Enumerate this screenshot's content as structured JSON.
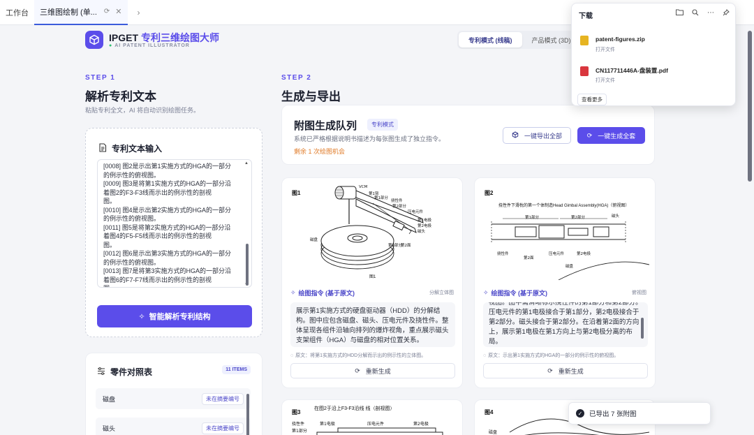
{
  "browser": {
    "tabs": [
      {
        "label": "工作台"
      },
      {
        "label": "三维图绘制 (单..."
      }
    ]
  },
  "header": {
    "brand_en": "IPGET",
    "brand_zh": "专利三维绘图大师",
    "subtitle": "AI PATENT ILLUSTRATOR",
    "modes": [
      "专利模式 (线稿)",
      "产品模式 (3D)"
    ],
    "active_mode": 0
  },
  "step1": {
    "label": "STEP 1",
    "title": "解析专利文本",
    "desc": "粘贴专利全文，AI 将自动识别绘图任务。",
    "input_title": "专利文本输入",
    "lines": [
      "[0008] 图2是示出第1实施方式的HGA的一部分",
      "的例示性的俯视图。",
      "[0009] 图3是将第1实施方式的HGA的一部分沿",
      "着图2的F3-F3线而示出的例示性的剖视",
      "图。",
      "[0010] 图4是示出第2实施方式的HGA的一部分",
      "的例示性的俯视图。",
      "[0011] 图5是将第2实施方式的HGA的一部分沿",
      "着图4的F5-F5线而示出的例示性的剖视",
      "图。",
      "[0012] 图6是示出第3实施方式的HGA的一部分",
      "的例示性的俯视图。",
      "[0013] 图7是将第3实施方式的HGA的一部分沿",
      "着图6的F7-F7线而示出的例示性的剖视",
      "图"
    ],
    "analyze_button": "智能解析专利结构"
  },
  "parts": {
    "title": "零件对照表",
    "count_badge": "11 ITEMS",
    "rows": [
      {
        "name": "磁盘",
        "tag": "未在摘要编号"
      },
      {
        "name": "磁头",
        "tag": "未在摘要编号"
      }
    ]
  },
  "step2": {
    "label": "STEP 2",
    "title": "生成与导出"
  },
  "queue": {
    "title": "附图生成队列",
    "badge": "专利模式",
    "desc": "系统已严格根据说明书描述为每张图生成了独立指令。",
    "remaining": "剩余 1 次绘图机会",
    "export_all": "一键导出全部",
    "generate_all": "一键生成全套"
  },
  "figures": [
    {
      "fig_label": "图1",
      "caption": "图1",
      "instr_title": "绘图指令 (基于原文)",
      "type": "分解立体图",
      "instruction": "展示第1实施方式的硬盘驱动器（HDD）的分解结构。图中应包含磁盘、磁头、压电元件及挠性件。整体呈现各组件沿轴向排列的爆炸视角，重点展示磁头支架组件（HGA）与磁盘的相对位置关系。",
      "source": "原文：将第1实施方式的HDD分解而示出的例示性的立体图。",
      "regen": "重新生成",
      "labels": [
        "VCM",
        "第1臂",
        "第1部分",
        "挠性件",
        "第2部分",
        "压电元件",
        "第1电极",
        "第2电极",
        "磁头",
        "磁盘",
        "第2部分",
        "第2面"
      ]
    },
    {
      "fig_label": "图2",
      "caption": "挠性件下滑枕的第一个体制造Head Gimbal Assembly(HGA)（俯视图）",
      "instr_title": "绘图指令 (基于原文)",
      "type": "俯视图",
      "instruction": "视图。图中需清晰标示挠性件的第1部分和第2部分。压电元件的第1电极接合于第1部分，第2电极接合于第2部分。磁头接合于第2部分。在沿着第2面的方向上，展示第1电极在第1方向上与第2电极分离的布局。",
      "source": "原文：示出第1实施方式的HGA的一部分的例示性的俯视图。",
      "regen": "重新生成",
      "labels": [
        "第1部分",
        "第2部分",
        "磁头",
        "挠性件",
        "第2面",
        "压电元件",
        "第2电极",
        "磁盘"
      ]
    },
    {
      "fig_label": "图3",
      "caption": "在图2于沿上F3-F3沿线 线（剖视图）",
      "labels": [
        "挠性件",
        "第1部分",
        "第1电极",
        "压电元件",
        "第2电极",
        "挠性件"
      ]
    },
    {
      "fig_label": "图4",
      "labels": [
        "磁盘",
        "第1电极",
        "第2面"
      ]
    }
  ],
  "downloads": {
    "title": "下载",
    "items": [
      {
        "name": "patent-figures.zip",
        "action": "打开文件",
        "color": "#e6b422"
      },
      {
        "name": "CN117711446A-盘装置.pdf",
        "action": "打开文件",
        "color": "#d9363e"
      }
    ],
    "more": "查看更多"
  },
  "toast": {
    "message": "已导出 7 张附图"
  }
}
